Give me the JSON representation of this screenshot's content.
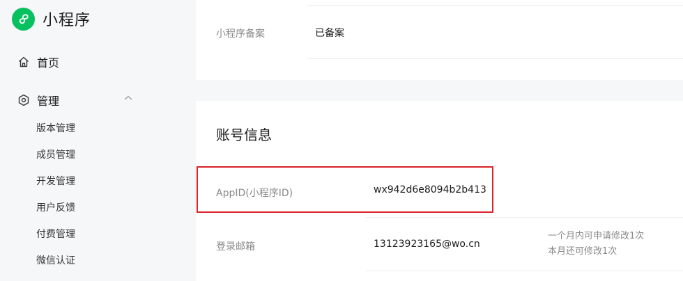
{
  "app": {
    "title": "小程序",
    "brand_color": "#07c160"
  },
  "sidebar": {
    "home_label": "首页",
    "manage_label": "管理",
    "sub_items": [
      "版本管理",
      "成员管理",
      "开发管理",
      "用户反馈",
      "付费管理",
      "微信认证"
    ]
  },
  "filing": {
    "label": "小程序备案",
    "value": "已备案"
  },
  "account": {
    "title": "账号信息",
    "appid_label": "AppID(小程序ID)",
    "appid_value": "wx942d6e8094b2b413",
    "email_label": "登录邮箱",
    "email_value": "13123923165@wo.cn",
    "email_hint_1": "一个月内可申请修改1次",
    "email_hint_2": "本月还可修改1次"
  },
  "highlight_color": "#d9222a",
  "icons": {
    "logo": "mini-program-logo-icon",
    "home": "home-icon",
    "manage": "settings-hexagon-icon",
    "collapse": "chevron-up-icon"
  }
}
